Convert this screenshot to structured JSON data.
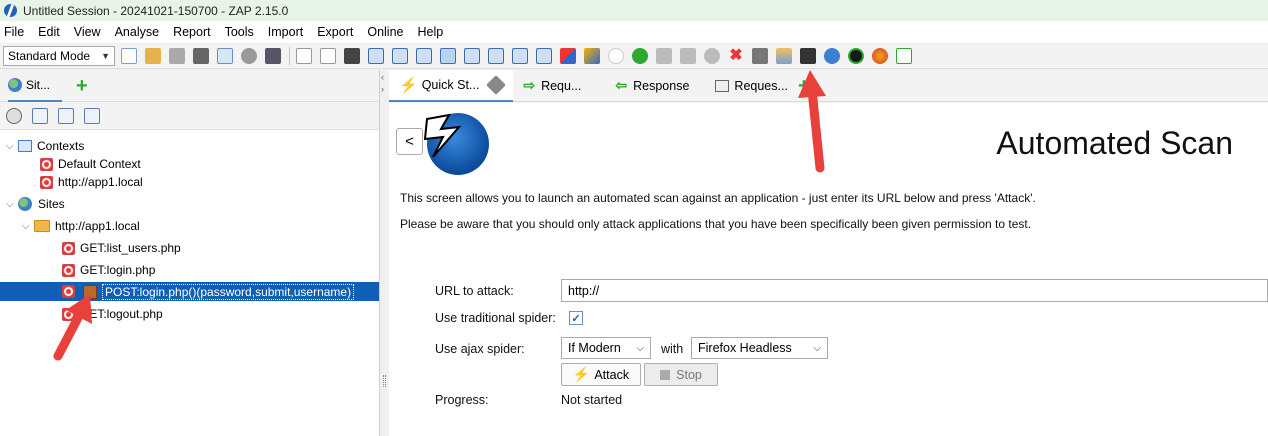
{
  "window": {
    "title": "Untitled Session - 20241021-150700 - ZAP 2.15.0"
  },
  "menu": [
    "File",
    "Edit",
    "View",
    "Analyse",
    "Report",
    "Tools",
    "Import",
    "Export",
    "Online",
    "Help"
  ],
  "toolbar": {
    "mode": "Standard Mode"
  },
  "left_panel": {
    "tab_label": "Sit...",
    "tree": {
      "contexts_label": "Contexts",
      "contexts": [
        "Default Context",
        "http://app1.local"
      ],
      "sites_label": "Sites",
      "site": "http://app1.local",
      "nodes": [
        "GET:list_users.php",
        "GET:login.php",
        "POST:login.php()(password,submit,username)",
        "GET:logout.php"
      ]
    }
  },
  "right_panel": {
    "tabs": [
      "Quick St...",
      "Requ...",
      "Response",
      "Reques..."
    ],
    "title": "Automated Scan",
    "back_label": "<",
    "description_1": "This screen allows you to launch an automated scan against  an application - just enter its URL below and press 'Attack'.",
    "description_2": "Please be aware that you should only attack applications that you have been specifically been given permission to test.",
    "form": {
      "url_label": "URL to attack:",
      "url_value": "http://",
      "traditional_spider_label": "Use traditional spider:",
      "traditional_spider_checked": true,
      "ajax_spider_label": "Use ajax spider:",
      "ajax_spider_option": "If Modern",
      "with_label": "with",
      "browser_option": "Firefox Headless",
      "attack_label": "Attack",
      "stop_label": "Stop",
      "progress_label": "Progress:",
      "progress_value": "Not started"
    }
  },
  "colors": {
    "selection": "#0f5fb8",
    "annotation_arrow": "#e8403a"
  }
}
